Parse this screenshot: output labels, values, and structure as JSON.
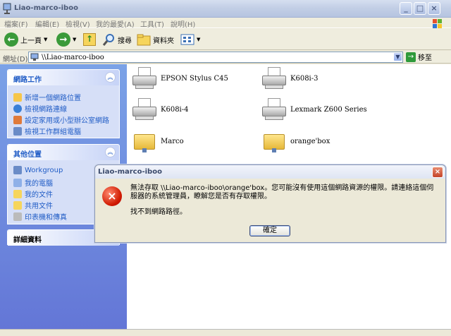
{
  "window": {
    "title": "Liao-marco-iboo"
  },
  "menu": [
    "檔案(F)",
    "編輯(E)",
    "檢視(V)",
    "我的最愛(A)",
    "工具(T)",
    "說明(H)"
  ],
  "toolbar": {
    "back": "上一頁",
    "search": "搜尋",
    "folders": "資料夾"
  },
  "address": {
    "label": "網址(D)",
    "value": "\\\\Liao-marco-iboo",
    "go": "移至"
  },
  "left": {
    "network_tasks": {
      "title": "網路工作",
      "items": [
        "新增一個網路位置",
        "檢視網路連線",
        "設定家用或小型辦公室網路",
        "檢視工作群組電腦"
      ]
    },
    "other_places": {
      "title": "其他位置",
      "items": [
        "Workgroup",
        "我的電腦",
        "我的文件",
        "共用文件",
        "印表機和傳真"
      ]
    },
    "details": {
      "title": "詳細資料"
    }
  },
  "content": {
    "items": [
      {
        "name": "EPSON Stylus C45",
        "type": "printer"
      },
      {
        "name": "K608i-3",
        "type": "printer"
      },
      {
        "name": "K608i-4",
        "type": "printer"
      },
      {
        "name": "Lexmark Z600 Series",
        "type": "printer"
      },
      {
        "name": "Marco",
        "type": "share"
      },
      {
        "name": "orange'box",
        "type": "share"
      }
    ]
  },
  "dialog": {
    "title": "Liao-marco-iboo",
    "message": "無法存取 \\\\Liao-marco-iboo\\orange'box。您可能沒有使用這個網路資源的權限。請連絡這個伺服器的系統管理員，瞭解您是否有存取權限。",
    "detail": "找不到網路路徑。",
    "ok": "確定"
  },
  "colors": {
    "link": "#215dc6",
    "pane_bg": "#6375d6",
    "error_red": "#d01a00"
  }
}
